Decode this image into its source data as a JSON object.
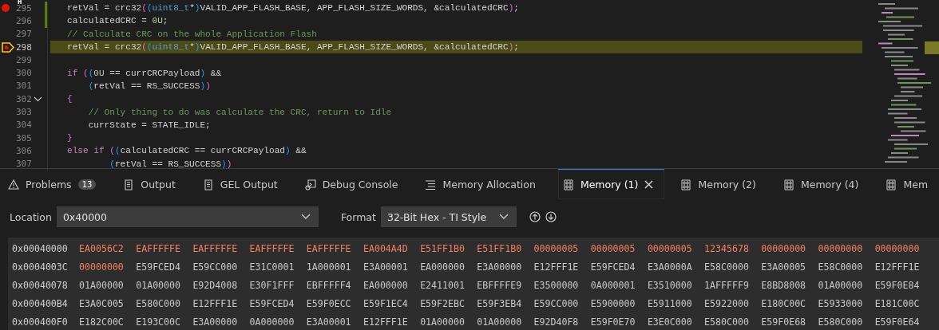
{
  "editor": {
    "gutter_badge": "H",
    "lines": [
      {
        "number": "295",
        "breakpoint": true,
        "current": false,
        "modified": true,
        "foldable": false,
        "tokens": [
          {
            "kind": "text",
            "text": "retVal = crc32"
          },
          {
            "kind": "bracket1",
            "text": "("
          },
          {
            "kind": "bracket2",
            "text": "("
          },
          {
            "kind": "type",
            "text": "uint8_t"
          },
          {
            "kind": "text",
            "text": "*"
          },
          {
            "kind": "bracket2",
            "text": ")"
          },
          {
            "kind": "text",
            "text": "VALID_APP_FLASH_BASE, APP_FLASH_SIZE_WORDS, &calculatedCRC"
          },
          {
            "kind": "bracket1",
            "text": ")"
          },
          {
            "kind": "text",
            "text": ";"
          }
        ]
      },
      {
        "number": "296",
        "breakpoint": false,
        "current": false,
        "modified": true,
        "foldable": false,
        "tokens": [
          {
            "kind": "text",
            "text": "calculatedCRC = "
          },
          {
            "kind": "number",
            "text": "0U"
          },
          {
            "kind": "text",
            "text": ";"
          }
        ]
      },
      {
        "number": "297",
        "breakpoint": false,
        "current": false,
        "modified": false,
        "foldable": false,
        "tokens": [
          {
            "kind": "comment",
            "text": "// Calculate CRC on the whole Application Flash"
          }
        ]
      },
      {
        "number": "298",
        "breakpoint": false,
        "current": true,
        "modified": false,
        "foldable": false,
        "tokens": [
          {
            "kind": "text",
            "text": "retVal = crc32"
          },
          {
            "kind": "bracket1",
            "text": "("
          },
          {
            "kind": "bracket2",
            "text": "("
          },
          {
            "kind": "type",
            "text": "uint8_t"
          },
          {
            "kind": "text",
            "text": "*"
          },
          {
            "kind": "bracket2",
            "text": ")"
          },
          {
            "kind": "text",
            "text": "VALID_APP_FLASH_BASE, APP_FLASH_SIZE_WORDS, &calculatedCRC"
          },
          {
            "kind": "bracket1",
            "text": ")"
          },
          {
            "kind": "text",
            "text": ";"
          }
        ]
      },
      {
        "number": "299",
        "breakpoint": false,
        "current": false,
        "modified": false,
        "foldable": false
      },
      {
        "number": "300",
        "breakpoint": false,
        "current": false,
        "modified": false,
        "foldable": false,
        "tokens": [
          {
            "kind": "keyword",
            "text": "if "
          },
          {
            "kind": "bracket1",
            "text": "("
          },
          {
            "kind": "bracket2",
            "text": "("
          },
          {
            "kind": "number",
            "text": "0U"
          },
          {
            "kind": "text",
            "text": " == currCRCPayload"
          },
          {
            "kind": "bracket2",
            "text": ")"
          },
          {
            "kind": "text",
            "text": " &&"
          }
        ]
      },
      {
        "number": "301",
        "breakpoint": false,
        "current": false,
        "modified": false,
        "foldable": false,
        "tokens": [
          {
            "kind": "bracket2",
            "text": "    ("
          },
          {
            "kind": "text",
            "text": "retVal == RS_SUCCESS"
          },
          {
            "kind": "bracket2",
            "text": ")"
          },
          {
            "kind": "bracket1",
            "text": ")"
          }
        ]
      },
      {
        "number": "302",
        "breakpoint": false,
        "current": false,
        "modified": false,
        "foldable": true,
        "tokens": [
          {
            "kind": "bracket1",
            "text": "{"
          }
        ]
      },
      {
        "number": "303",
        "breakpoint": false,
        "current": false,
        "modified": false,
        "foldable": false,
        "tokens": [
          {
            "kind": "comment",
            "text": "    // Only thing to do was calculate the CRC, return to Idle"
          }
        ]
      },
      {
        "number": "304",
        "breakpoint": false,
        "current": false,
        "modified": false,
        "foldable": false,
        "tokens": [
          {
            "kind": "text",
            "text": "    currState = STATE_IDLE;"
          }
        ]
      },
      {
        "number": "305",
        "breakpoint": false,
        "current": false,
        "modified": false,
        "foldable": false,
        "tokens": [
          {
            "kind": "bracket1",
            "text": "}"
          }
        ]
      },
      {
        "number": "306",
        "breakpoint": false,
        "current": false,
        "modified": false,
        "foldable": false,
        "tokens": [
          {
            "kind": "keyword",
            "text": "else "
          },
          {
            "kind": "keyword",
            "text": "if "
          },
          {
            "kind": "bracket1",
            "text": "("
          },
          {
            "kind": "bracket2",
            "text": "("
          },
          {
            "kind": "text",
            "text": "calculatedCRC == currCRCPayload"
          },
          {
            "kind": "bracket2",
            "text": ")"
          },
          {
            "kind": "text",
            "text": " &&"
          }
        ]
      },
      {
        "number": "307",
        "breakpoint": false,
        "current": false,
        "modified": false,
        "foldable": false,
        "tokens": [
          {
            "kind": "bracket2",
            "text": "        ("
          },
          {
            "kind": "text",
            "text": "retVal == RS_SUCCESS"
          },
          {
            "kind": "bracket2",
            "text": ")"
          },
          {
            "kind": "bracket1",
            "text": ")"
          }
        ]
      }
    ]
  },
  "panel": {
    "tabs": [
      {
        "label": "Problems",
        "kind": "warning",
        "badge": "13",
        "selected": false
      },
      {
        "label": "Output",
        "kind": "document",
        "selected": false
      },
      {
        "label": "GEL Output",
        "kind": "document",
        "selected": false
      },
      {
        "label": "Debug Console",
        "kind": "debug",
        "selected": false
      },
      {
        "label": "Memory Allocation",
        "kind": "list",
        "selected": false
      },
      {
        "label": "Memory (1)",
        "kind": "memory",
        "selected": true,
        "closable": true
      },
      {
        "label": "Memory (2)",
        "kind": "memory",
        "selected": false
      },
      {
        "label": "Memory (4)",
        "kind": "memory",
        "selected": false
      },
      {
        "label": "Mem",
        "kind": "memory",
        "selected": false
      }
    ]
  },
  "memory": {
    "location_label": "Location",
    "location": "0x40000",
    "format_label": "Format",
    "format": "32-Bit Hex - TI Style",
    "rows": [
      {
        "address": "0x00040000",
        "words": [
          {
            "value": "EA0056C2",
            "changed": true
          },
          {
            "value": "EAFFFFFE",
            "changed": true
          },
          {
            "value": "EAFFFFFE",
            "changed": true
          },
          {
            "value": "EAFFFFFE",
            "changed": true
          },
          {
            "value": "EAFFFFFE",
            "changed": true
          },
          {
            "value": "EA004A4D",
            "changed": true
          },
          {
            "value": "E51FF1B0",
            "changed": true
          },
          {
            "value": "E51FF1B0",
            "changed": true
          },
          {
            "value": "00000005",
            "changed": true
          },
          {
            "value": "00000005",
            "changed": true
          },
          {
            "value": "00000005",
            "changed": true
          },
          {
            "value": "12345678",
            "changed": true
          },
          {
            "value": "00000000",
            "changed": true
          },
          {
            "value": "00000000",
            "changed": true
          },
          {
            "value": "00000000",
            "changed": true
          }
        ]
      },
      {
        "address": "0x0004003C",
        "words": [
          {
            "value": "00000000",
            "changed": true
          },
          {
            "value": "E59FCED4",
            "changed": false
          },
          {
            "value": "E59CC000",
            "changed": false
          },
          {
            "value": "E31C0001",
            "changed": false
          },
          {
            "value": "1A000001",
            "changed": false
          },
          {
            "value": "E3A00001",
            "changed": false
          },
          {
            "value": "EA000000",
            "changed": false
          },
          {
            "value": "E3A00000",
            "changed": false
          },
          {
            "value": "E12FFF1E",
            "changed": false
          },
          {
            "value": "E59FCED4",
            "changed": false
          },
          {
            "value": "E3A0000A",
            "changed": false
          },
          {
            "value": "E58C0000",
            "changed": false
          },
          {
            "value": "E3A00005",
            "changed": false
          },
          {
            "value": "E58C0000",
            "changed": false
          },
          {
            "value": "E12FFF1E",
            "changed": false
          }
        ]
      },
      {
        "address": "0x00040078",
        "words": [
          {
            "value": "01A00000",
            "changed": false
          },
          {
            "value": "01A00000",
            "changed": false
          },
          {
            "value": "E92D4008",
            "changed": false
          },
          {
            "value": "E30F1FFF",
            "changed": false
          },
          {
            "value": "EBFFFFF4",
            "changed": false
          },
          {
            "value": "EA000000",
            "changed": false
          },
          {
            "value": "E2411001",
            "changed": false
          },
          {
            "value": "EBFFFFE9",
            "changed": false
          },
          {
            "value": "E3500000",
            "changed": false
          },
          {
            "value": "0A000001",
            "changed": false
          },
          {
            "value": "E3510000",
            "changed": false
          },
          {
            "value": "1AFFFFF9",
            "changed": false
          },
          {
            "value": "E8BD8008",
            "changed": false
          },
          {
            "value": "01A00000",
            "changed": false
          },
          {
            "value": "E59F0E84",
            "changed": false
          }
        ]
      },
      {
        "address": "0x000400B4",
        "words": [
          {
            "value": "E3A0C005",
            "changed": false
          },
          {
            "value": "E580C000",
            "changed": false
          },
          {
            "value": "E12FFF1E",
            "changed": false
          },
          {
            "value": "E59FCED4",
            "changed": false
          },
          {
            "value": "E59F0ECC",
            "changed": false
          },
          {
            "value": "E59F1EC4",
            "changed": false
          },
          {
            "value": "E59F2EBC",
            "changed": false
          },
          {
            "value": "E59F3EB4",
            "changed": false
          },
          {
            "value": "E59CC000",
            "changed": false
          },
          {
            "value": "E5900000",
            "changed": false
          },
          {
            "value": "E5911000",
            "changed": false
          },
          {
            "value": "E5922000",
            "changed": false
          },
          {
            "value": "E180C00C",
            "changed": false
          },
          {
            "value": "E5933000",
            "changed": false
          },
          {
            "value": "E181C00C",
            "changed": false
          }
        ]
      },
      {
        "address": "0x000400F0",
        "words": [
          {
            "value": "E182C00C",
            "changed": false
          },
          {
            "value": "E193C00C",
            "changed": false
          },
          {
            "value": "E3A00000",
            "changed": false
          },
          {
            "value": "0A000000",
            "changed": false
          },
          {
            "value": "E3A00001",
            "changed": false
          },
          {
            "value": "E12FFF1E",
            "changed": false
          },
          {
            "value": "01A00000",
            "changed": false
          },
          {
            "value": "01A00000",
            "changed": false
          },
          {
            "value": "E92D40F8",
            "changed": false
          },
          {
            "value": "E59F0E70",
            "changed": false
          },
          {
            "value": "E3E0C000",
            "changed": false
          },
          {
            "value": "E580C000",
            "changed": false
          },
          {
            "value": "E59F0E68",
            "changed": false
          },
          {
            "value": "E580C000",
            "changed": false
          },
          {
            "value": "E59F0E64",
            "changed": false
          }
        ]
      }
    ]
  }
}
